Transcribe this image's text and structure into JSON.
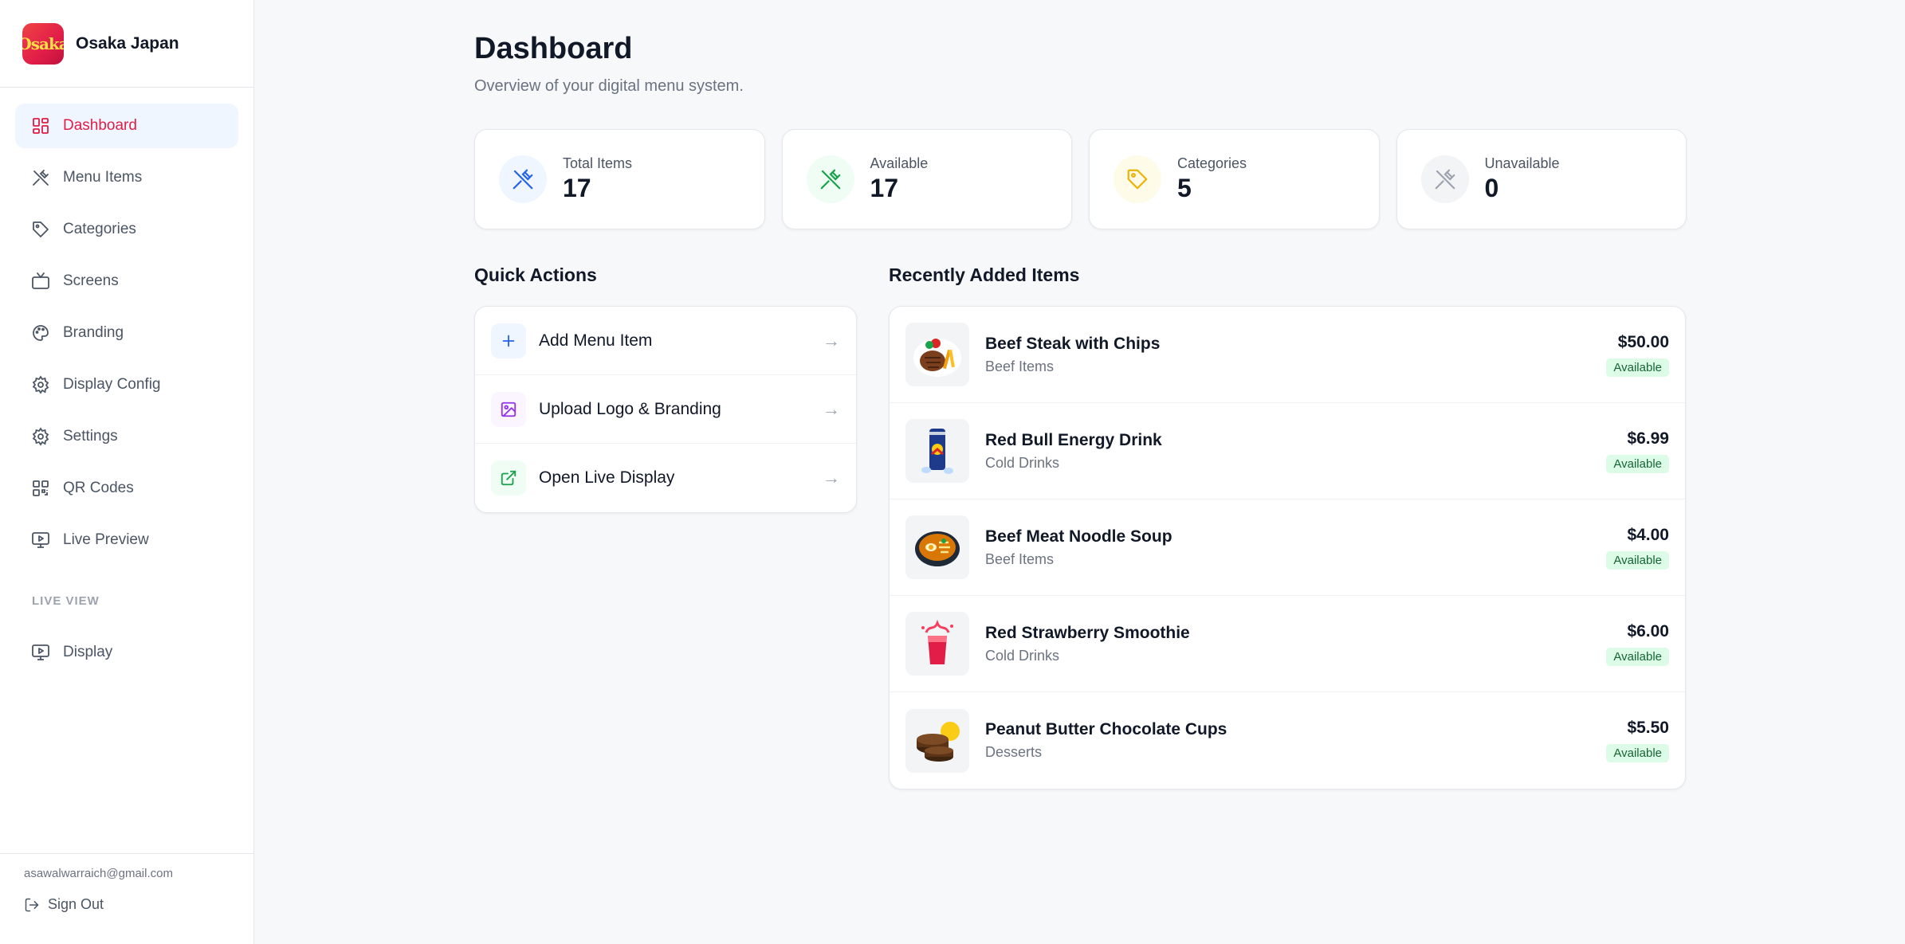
{
  "brand": {
    "name": "Osaka Japan",
    "logo_text": "Osaka"
  },
  "nav": {
    "items": [
      {
        "label": "Dashboard",
        "icon": "grid-icon",
        "active": true
      },
      {
        "label": "Menu Items",
        "icon": "utensils-icon"
      },
      {
        "label": "Categories",
        "icon": "tag-icon"
      },
      {
        "label": "Screens",
        "icon": "tv-icon"
      },
      {
        "label": "Branding",
        "icon": "palette-icon"
      },
      {
        "label": "Display Config",
        "icon": "gear-icon"
      },
      {
        "label": "Settings",
        "icon": "gear-icon"
      },
      {
        "label": "QR Codes",
        "icon": "qr-code-icon"
      },
      {
        "label": "Live Preview",
        "icon": "monitor-play-icon"
      }
    ],
    "live_section_label": "LIVE VIEW",
    "live_items": [
      {
        "label": "Display",
        "icon": "monitor-play-icon"
      }
    ]
  },
  "footer": {
    "email": "asawalwarraich@gmail.com",
    "signout_label": "Sign Out"
  },
  "page": {
    "title": "Dashboard",
    "subtitle": "Overview of your digital menu system."
  },
  "stats": [
    {
      "label": "Total Items",
      "value": "17",
      "icon": "utensils-icon",
      "color": "#2563eb",
      "bg": "#eff6ff"
    },
    {
      "label": "Available",
      "value": "17",
      "icon": "utensils-icon",
      "color": "#16a34a",
      "bg": "#f0fdf4"
    },
    {
      "label": "Categories",
      "value": "5",
      "icon": "tag-icon",
      "color": "#eab308",
      "bg": "#fefce8"
    },
    {
      "label": "Unavailable",
      "value": "0",
      "icon": "utensils-icon",
      "color": "#9ca3af",
      "bg": "#f3f4f6"
    }
  ],
  "quick_actions": {
    "title": "Quick Actions",
    "items": [
      {
        "label": "Add Menu Item",
        "icon": "plus-icon",
        "color": "#2563eb",
        "bg": "#eff6ff",
        "arrow": "→"
      },
      {
        "label": "Upload Logo & Branding",
        "icon": "image-icon",
        "color": "#9333ea",
        "bg": "#faf5ff",
        "arrow": "→"
      },
      {
        "label": "Open Live Display",
        "icon": "external-link-icon",
        "color": "#16a34a",
        "bg": "#f0fdf4",
        "arrow": "→"
      }
    ]
  },
  "recent": {
    "title": "Recently Added Items",
    "items": [
      {
        "name": "Beef Steak with Chips",
        "category": "Beef Items",
        "price": "$50.00",
        "status": "Available",
        "thumb": "steak-image"
      },
      {
        "name": "Red Bull Energy Drink",
        "category": "Cold Drinks",
        "price": "$6.99",
        "status": "Available",
        "thumb": "can-image"
      },
      {
        "name": "Beef Meat Noodle Soup",
        "category": "Beef Items",
        "price": "$4.00",
        "status": "Available",
        "thumb": "bowl-image"
      },
      {
        "name": "Red Strawberry Smoothie",
        "category": "Cold Drinks",
        "price": "$6.00",
        "status": "Available",
        "thumb": "smoothie-image"
      },
      {
        "name": "Peanut Butter Chocolate Cups",
        "category": "Desserts",
        "price": "$5.50",
        "status": "Available",
        "thumb": "dessert-image"
      }
    ]
  }
}
